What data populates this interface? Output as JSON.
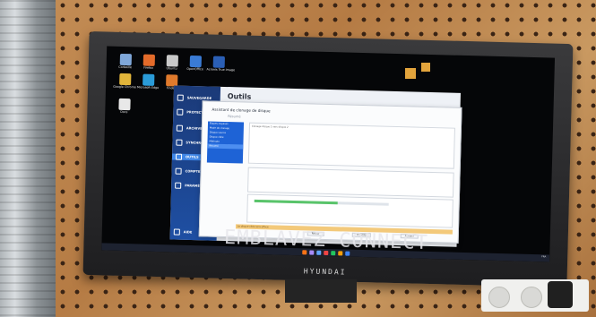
{
  "scene": {
    "monitor_brand": "HYUNDAI",
    "reflection_text": "EMBLAVEZ CONNECT"
  },
  "desktop": {
    "icons": [
      {
        "label": "Corbeille",
        "color": "#7fa7d9"
      },
      {
        "label": "Firefox",
        "color": "#e36b2a"
      },
      {
        "label": "Ubuntu",
        "color": "#c9c9c9"
      },
      {
        "label": "OpenOffice",
        "color": "#3a7bd5"
      },
      {
        "label": "Acronis True Image",
        "color": "#2b5fb5"
      },
      {
        "label": "Google Chrome",
        "color": "#e0b43a"
      },
      {
        "label": "Microsoft Edge",
        "color": "#2a9bd8"
      },
      {
        "label": "Finder",
        "color": "#e07a2c"
      },
      {
        "label": "Docs",
        "color": "#e8e8e8"
      }
    ]
  },
  "app": {
    "window_title": "Outils",
    "nav": [
      {
        "label": "SAUVEGARDE",
        "active": false
      },
      {
        "label": "PROTECTION",
        "active": false
      },
      {
        "label": "ARCHIVER",
        "active": false
      },
      {
        "label": "SYNCHRONISER",
        "active": false
      },
      {
        "label": "OUTILS",
        "active": true
      },
      {
        "label": "COMPTE",
        "active": false
      },
      {
        "label": "PARAMÈTRES",
        "active": false
      },
      {
        "label": "AIDE",
        "active": false
      }
    ]
  },
  "dialog": {
    "title": "Assistant de clonage de disque",
    "subtitle": "Résumé",
    "steps": [
      "Étapes requises",
      "Mode de clonage",
      "Disque source",
      "Disque cible",
      "Méthode",
      "Résumé"
    ],
    "active_step": 5,
    "summary_text": "Clonage disque 1 vers disque 2",
    "progress": 0.62,
    "warning": "Le disque cible sera effacé",
    "buttons": [
      "Retour",
      "Procéder",
      "Annuler"
    ]
  },
  "taskbar": {
    "icons": [
      "#3b82f6",
      "#f59e0b",
      "#22c55e",
      "#ef4444",
      "#60a5fa",
      "#a78bfa",
      "#f97316"
    ],
    "tray_text": "FRA"
  }
}
